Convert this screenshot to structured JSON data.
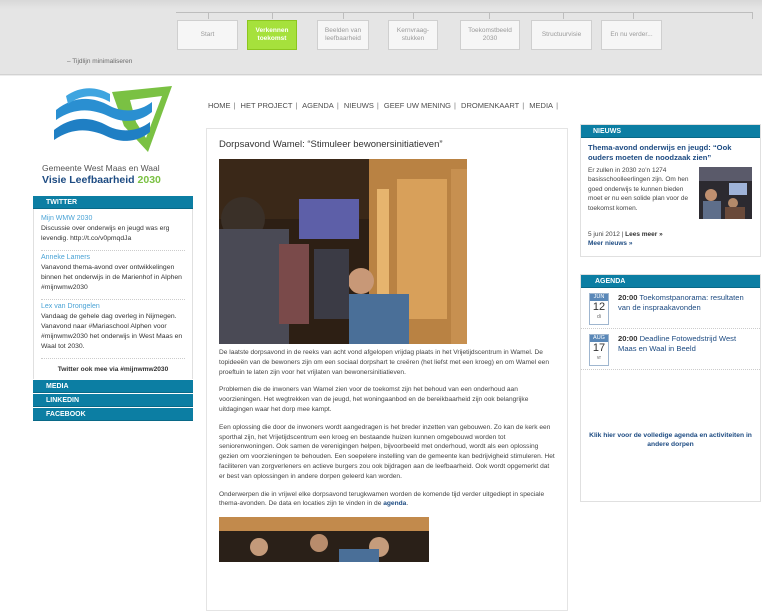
{
  "timeline": {
    "minimize_label": "–  Tijdlijn minimaliseren",
    "steps": [
      {
        "label": "Start"
      },
      {
        "label": "Verkennen toekomst"
      },
      {
        "label": "Beelden van leefbaarheid"
      },
      {
        "label": "Kernvraag-stukken"
      },
      {
        "label": "Toekomstbeeld 2030"
      },
      {
        "label": "Structuurvisie"
      },
      {
        "label": "En nu verder..."
      }
    ],
    "active_step": "Verkennen toekomst"
  },
  "logo": {
    "org": "Gemeente West Maas en Waal",
    "title": "Visie Leefbaarheid",
    "year": "2030"
  },
  "topnav": [
    "HOME",
    "HET PROJECT",
    "AGENDA",
    "NIEUWS",
    "GEEF UW MENING",
    "DROMENKAART",
    "MEDIA"
  ],
  "left_sidebar": {
    "twitter_header": "TWITTER",
    "tweets": [
      {
        "author": "Mijn WMW 2030",
        "text": "Discussie over onderwijs en jeugd was erg levendig. http://t.co/v0pmqdJa"
      },
      {
        "author": "Anneke Lamers",
        "text": "Vanavond thema-avond over ontwikkelingen binnen het onderwijs in de Marienhof in Alphen #mijnwmw2030"
      },
      {
        "author": "Lex van Drongelen",
        "text": "Vandaag de gehele dag overleg in Nijmegen. Vanavond naar #Mariaschool Alphen voor #mijnwmw2030 het onderwijs in West Maas en Waal tot 2030."
      }
    ],
    "follow": "Twitter ook mee via #mijnwmw2030",
    "blocks": [
      "MEDIA",
      "LINKEDIN",
      "FACEBOOK"
    ]
  },
  "article": {
    "title": "Dorpsavond Wamel: “Stimuleer bewonersinitiatieven”",
    "paragraphs": [
      "De laatste dorpsavond in de reeks van acht vond afgelopen vrijdag plaats in het Vrijetijdscentrum in Wamel. De topideeën van de bewoners zijn om een sociaal dorpshart te creëren (het liefst met een kroeg) en om Wamel een proeftuin te laten zijn voor het vrijlaten van bewonersinitiatieven.",
      "Problemen die de inwoners van Wamel zien voor de toekomst zijn het behoud van een onderhoud aan voorzieningen. Het wegtrekken van de jeugd, het woningaanbod en de bereikbaarheid zijn ook belangrijke uitdagingen waar het dorp mee kampt.",
      "Een oplossing die door de inwoners wordt aangedragen is het breder inzetten van gebouwen. Zo kan de kerk een sporthal zijn, het Vrijetijdscentrum een kroeg en bestaande huizen kunnen omgebouwd worden tot seniorenwoningen. Ook samen de verenigingen helpen, bijvoorbeeld met onderhoud, wordt als een oplossing gezien om voorzieningen te behouden. Een soepelere instelling van de gemeente kan bedrijvigheid stimuleren. Het faciliteren van zorgverleners en actieve burgers zou ook bijdragen aan de leefbaarheid. Ook wordt opgemerkt dat er best van oplossingen in andere dorpen geleerd kan worden."
    ],
    "last_para_text": "Onderwerpen die in vrijwel elke dorpsavond terugkwamen worden de komende tijd verder uitgediept in speciale thema-avonden. De data en locaties zijn te vinden in de ",
    "last_para_link": "agenda",
    "last_para_end": "."
  },
  "news": {
    "header": "NIEUWS",
    "title": "Thema-avond onderwijs en jeugd: “Ook ouders moeten de noodzaak zien”",
    "text": "Er zullen in 2030 zo’n 1274 basisschoolleerlingen zijn. Om hen goed onderwijs te kunnen bieden moet er nu een solide plan voor de toekomst komen.",
    "date": "5 juni 2012",
    "read_more": "Lees meer »",
    "more_news": "Meer nieuws »"
  },
  "agenda": {
    "header": "AGENDA",
    "events": [
      {
        "month": "JUN",
        "day": "12",
        "dow": "di",
        "time": "20:00",
        "title": "Toekomstpanorama: resultaten van de inspraakavonden"
      },
      {
        "month": "AUG",
        "day": "17",
        "dow": "vr",
        "time": "20:00",
        "title": "Deadline Fotowedstrijd West Maas en Waal in Beeld"
      }
    ],
    "footer": "Klik hier voor de volledige agenda en activiteiten in andere dorpen"
  }
}
